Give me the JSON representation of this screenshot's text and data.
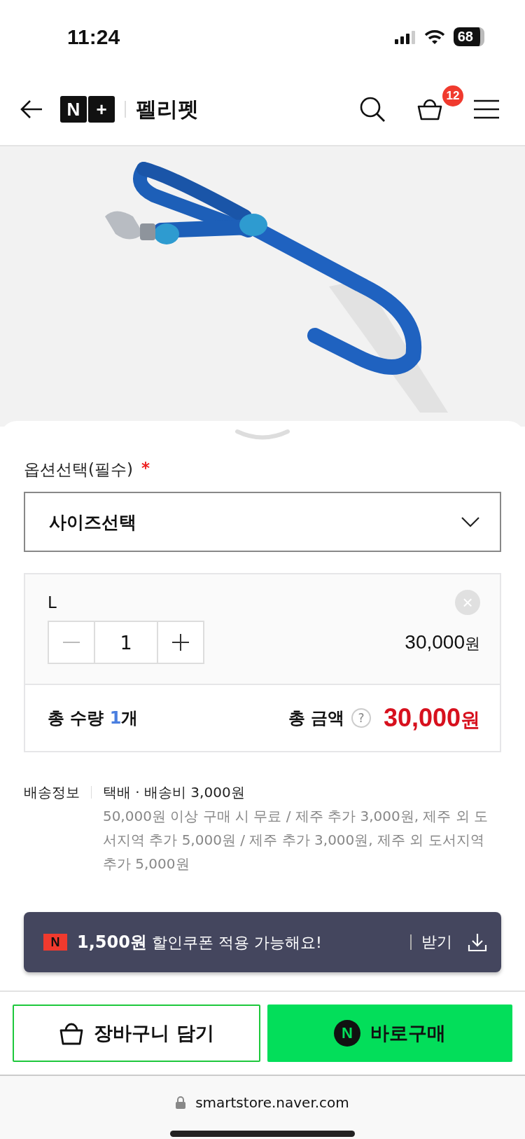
{
  "status_bar": {
    "time": "11:24",
    "battery": "68"
  },
  "header": {
    "logo": [
      "N",
      "+"
    ],
    "store_name": "펠리펫",
    "cart_count": "12"
  },
  "option_sheet": {
    "label": "옵션선택(필수)",
    "required_mark": "*",
    "select": {
      "value": "사이즈선택"
    },
    "selected_option": {
      "name": "L",
      "quantity": "1",
      "price": "30,000",
      "price_unit": "원",
      "remove_mark": "×"
    },
    "total": {
      "quantity_label": "총 수량",
      "quantity": "1",
      "quantity_unit": "개",
      "price_label": "총 금액",
      "help_mark": "?",
      "price": "30,000",
      "price_unit": "원"
    }
  },
  "shipping": {
    "label": "배송정보",
    "method": "택배 · 배송비 3,000원",
    "detail": "50,000원 이상 구매 시 무료 / 제주 추가 3,000원, 제주 외 도서지역 추가 5,000원 / 제주 추가 3,000원, 제주 외 도서지역 추가 5,000원"
  },
  "coupon": {
    "badge": "N",
    "text": "**1,500원** 할인쿠폰 적용 가능해요!",
    "action": "받기"
  },
  "buttons": {
    "cart": "장바구니 담기",
    "buy_badge": "N",
    "buy": "바로구매"
  },
  "browser": {
    "url": "smartstore.naver.com"
  }
}
